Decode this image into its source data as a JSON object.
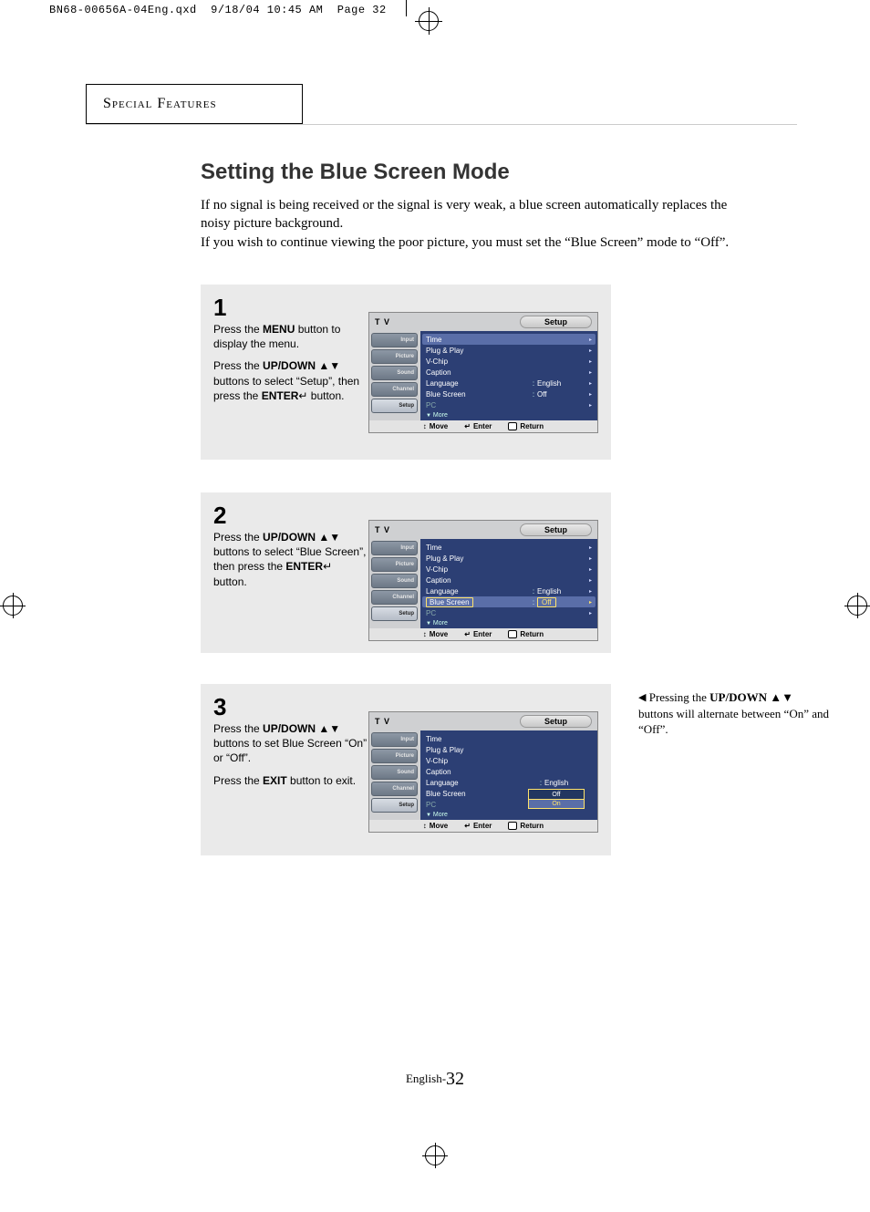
{
  "header_line": "BN68-00656A-04Eng.qxd  9/18/04 10:45 AM  Page 32",
  "section_label": "Special Features",
  "page_title": "Setting the Blue Screen Mode",
  "intro_p1": "If no signal is being received or the signal is very weak, a blue screen automatically replaces the noisy picture background.",
  "intro_p2": "If you wish to continue viewing the poor picture, you must set the “Blue Screen” mode to “Off”.",
  "steps": {
    "step1": {
      "num": "1",
      "p1a": "Press the ",
      "p1b": "MENU",
      "p1c": " button to display the menu.",
      "p2a": "Press the ",
      "p2b": "UP/DOWN",
      "p2c": " ▲▼ buttons to select “Setup”, then press the ",
      "p2d": "ENTER",
      "p2e": "↵ button."
    },
    "step2": {
      "num": "2",
      "p1a": "Press the ",
      "p1b": "UP/DOWN",
      "p1c": " ▲▼ buttons to select “Blue Screen”, then press the ",
      "p1d": "ENTER",
      "p1e": "↵ button."
    },
    "step3": {
      "num": "3",
      "p1a": "Press the ",
      "p1b": "UP/DOWN",
      "p1c": " ▲▼ buttons to set Blue Screen “On” or “Off”.",
      "p2a": "Press the ",
      "p2b": "EXIT",
      "p2c": " button to exit."
    }
  },
  "side_note": {
    "tri": "◀",
    "a": " Pressing the ",
    "b": "UP/DOWN",
    "c": " ▲▼ buttons will alternate between “On” and “Off”."
  },
  "tv": {
    "top": {
      "tv": "T V",
      "title": "Setup"
    },
    "tabs": [
      "Input",
      "Picture",
      "Sound",
      "Channel",
      "Setup"
    ],
    "menu": {
      "time": "Time",
      "plug": "Plug & Play",
      "vchip": "V-Chip",
      "caption": "Caption",
      "language": "Language",
      "language_val": "English",
      "blue": "Blue Screen",
      "blue_val": "Off",
      "pc": "PC",
      "more": "More"
    },
    "help": {
      "move": "Move",
      "enter": "Enter",
      "return": "Return"
    },
    "dropdown": {
      "off": "Off",
      "on": "On"
    }
  },
  "footer": {
    "lang": "English-",
    "page": "32"
  },
  "glyph": {
    "arrow_r": "▸",
    "updown": "↕",
    "enter": "↵",
    "down": "▼"
  }
}
